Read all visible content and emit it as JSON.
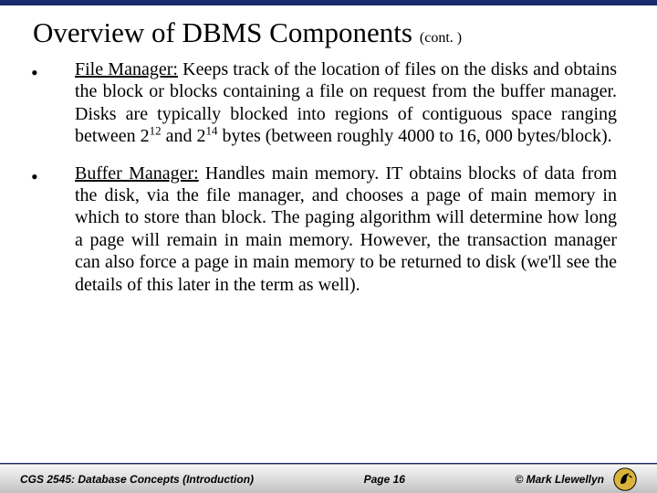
{
  "title": {
    "main": "Overview of DBMS Components",
    "cont": "(cont. )"
  },
  "items": [
    {
      "term": "File Manager:",
      "pre": "  Keeps track of the location of files on the disks and obtains the block or blocks containing a file on request from the buffer manager.  Disks are typically blocked into regions of contiguous space ranging between 2",
      "e1": "12",
      "mid": " and 2",
      "e2": "14",
      "post": " bytes (between roughly 4000 to 16, 000 bytes/block)."
    },
    {
      "term": "Buffer Manager:",
      "body": "  Handles main memory.  IT obtains blocks of data from the disk, via the file manager, and chooses a page of main memory in which to store than block.  The paging algorithm will determine how long a page will remain in main memory.  However, the transaction manager can also force a page in main memory to be returned to disk (we'll see the details of this later in the term as well)."
    }
  ],
  "footer": {
    "course": "CGS 2545: Database Concepts  (Introduction)",
    "page": "Page  16",
    "copyright": "© Mark Llewellyn"
  }
}
